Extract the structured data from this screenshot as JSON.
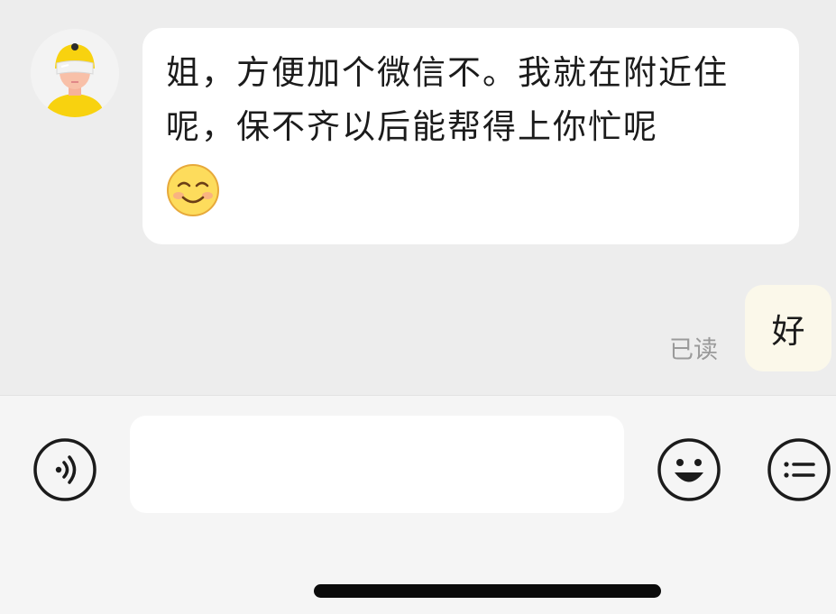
{
  "chat": {
    "incoming_message": {
      "text": "姐，方便加个微信不。我就在附近住呢，保不齐以后能帮得上你忙呢",
      "emoji": "smiling-face-emoji"
    },
    "outgoing_message": {
      "text": "好",
      "status": "已读"
    }
  },
  "input_bar": {
    "message_input_value": "",
    "message_input_placeholder": "",
    "icons": [
      "voice-icon",
      "emoji-icon",
      "more-menu-icon"
    ]
  },
  "colors": {
    "chat_background": "#ededed",
    "incoming_bubble": "#ffffff",
    "outgoing_bubble": "#fbf8ea",
    "read_status": "#9a9a9a",
    "avatar_accent": "#f8d20f"
  }
}
